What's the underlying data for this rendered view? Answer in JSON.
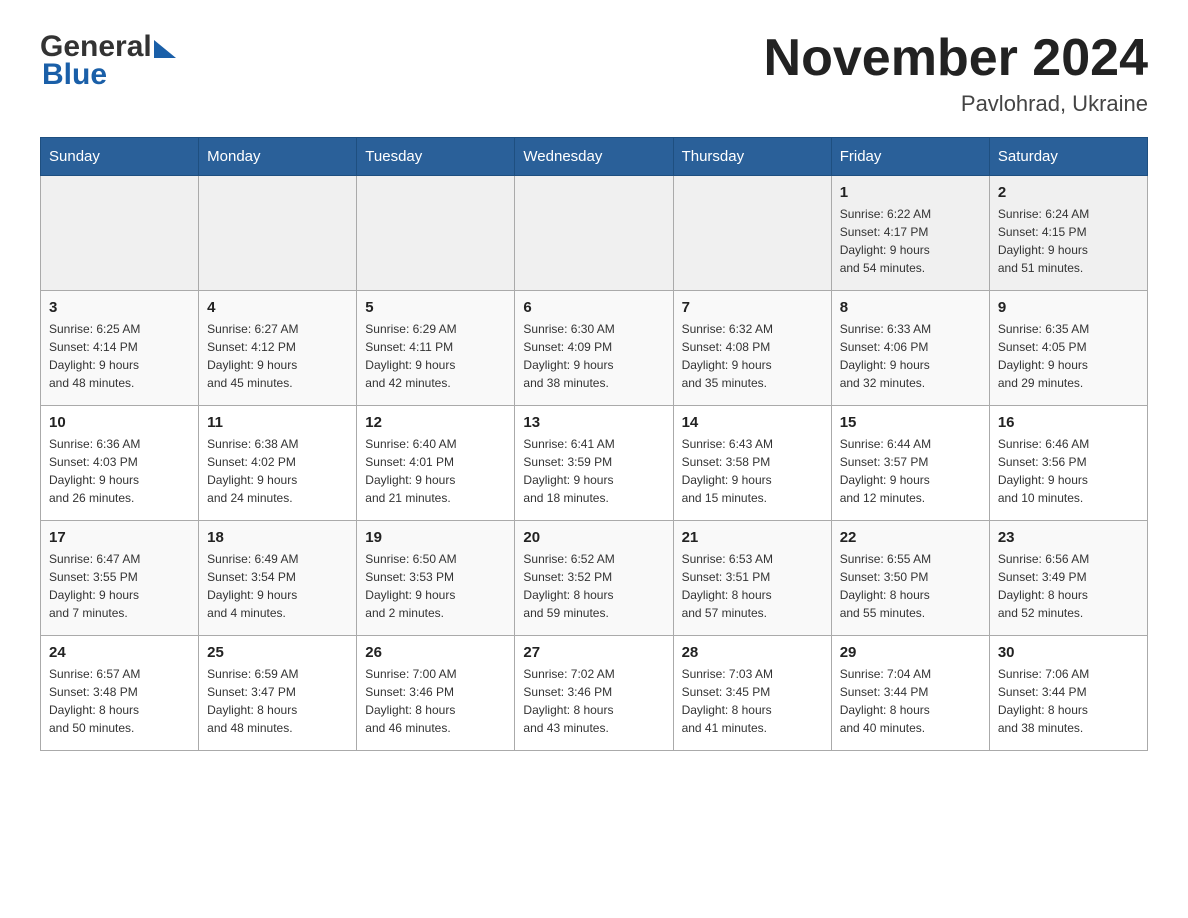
{
  "header": {
    "title": "November 2024",
    "subtitle": "Pavlohrad, Ukraine"
  },
  "logo": {
    "line1": "General",
    "line2": "Blue"
  },
  "days_of_week": [
    "Sunday",
    "Monday",
    "Tuesday",
    "Wednesday",
    "Thursday",
    "Friday",
    "Saturday"
  ],
  "weeks": [
    [
      {
        "day": "",
        "info": ""
      },
      {
        "day": "",
        "info": ""
      },
      {
        "day": "",
        "info": ""
      },
      {
        "day": "",
        "info": ""
      },
      {
        "day": "",
        "info": ""
      },
      {
        "day": "1",
        "info": "Sunrise: 6:22 AM\nSunset: 4:17 PM\nDaylight: 9 hours\nand 54 minutes."
      },
      {
        "day": "2",
        "info": "Sunrise: 6:24 AM\nSunset: 4:15 PM\nDaylight: 9 hours\nand 51 minutes."
      }
    ],
    [
      {
        "day": "3",
        "info": "Sunrise: 6:25 AM\nSunset: 4:14 PM\nDaylight: 9 hours\nand 48 minutes."
      },
      {
        "day": "4",
        "info": "Sunrise: 6:27 AM\nSunset: 4:12 PM\nDaylight: 9 hours\nand 45 minutes."
      },
      {
        "day": "5",
        "info": "Sunrise: 6:29 AM\nSunset: 4:11 PM\nDaylight: 9 hours\nand 42 minutes."
      },
      {
        "day": "6",
        "info": "Sunrise: 6:30 AM\nSunset: 4:09 PM\nDaylight: 9 hours\nand 38 minutes."
      },
      {
        "day": "7",
        "info": "Sunrise: 6:32 AM\nSunset: 4:08 PM\nDaylight: 9 hours\nand 35 minutes."
      },
      {
        "day": "8",
        "info": "Sunrise: 6:33 AM\nSunset: 4:06 PM\nDaylight: 9 hours\nand 32 minutes."
      },
      {
        "day": "9",
        "info": "Sunrise: 6:35 AM\nSunset: 4:05 PM\nDaylight: 9 hours\nand 29 minutes."
      }
    ],
    [
      {
        "day": "10",
        "info": "Sunrise: 6:36 AM\nSunset: 4:03 PM\nDaylight: 9 hours\nand 26 minutes."
      },
      {
        "day": "11",
        "info": "Sunrise: 6:38 AM\nSunset: 4:02 PM\nDaylight: 9 hours\nand 24 minutes."
      },
      {
        "day": "12",
        "info": "Sunrise: 6:40 AM\nSunset: 4:01 PM\nDaylight: 9 hours\nand 21 minutes."
      },
      {
        "day": "13",
        "info": "Sunrise: 6:41 AM\nSunset: 3:59 PM\nDaylight: 9 hours\nand 18 minutes."
      },
      {
        "day": "14",
        "info": "Sunrise: 6:43 AM\nSunset: 3:58 PM\nDaylight: 9 hours\nand 15 minutes."
      },
      {
        "day": "15",
        "info": "Sunrise: 6:44 AM\nSunset: 3:57 PM\nDaylight: 9 hours\nand 12 minutes."
      },
      {
        "day": "16",
        "info": "Sunrise: 6:46 AM\nSunset: 3:56 PM\nDaylight: 9 hours\nand 10 minutes."
      }
    ],
    [
      {
        "day": "17",
        "info": "Sunrise: 6:47 AM\nSunset: 3:55 PM\nDaylight: 9 hours\nand 7 minutes."
      },
      {
        "day": "18",
        "info": "Sunrise: 6:49 AM\nSunset: 3:54 PM\nDaylight: 9 hours\nand 4 minutes."
      },
      {
        "day": "19",
        "info": "Sunrise: 6:50 AM\nSunset: 3:53 PM\nDaylight: 9 hours\nand 2 minutes."
      },
      {
        "day": "20",
        "info": "Sunrise: 6:52 AM\nSunset: 3:52 PM\nDaylight: 8 hours\nand 59 minutes."
      },
      {
        "day": "21",
        "info": "Sunrise: 6:53 AM\nSunset: 3:51 PM\nDaylight: 8 hours\nand 57 minutes."
      },
      {
        "day": "22",
        "info": "Sunrise: 6:55 AM\nSunset: 3:50 PM\nDaylight: 8 hours\nand 55 minutes."
      },
      {
        "day": "23",
        "info": "Sunrise: 6:56 AM\nSunset: 3:49 PM\nDaylight: 8 hours\nand 52 minutes."
      }
    ],
    [
      {
        "day": "24",
        "info": "Sunrise: 6:57 AM\nSunset: 3:48 PM\nDaylight: 8 hours\nand 50 minutes."
      },
      {
        "day": "25",
        "info": "Sunrise: 6:59 AM\nSunset: 3:47 PM\nDaylight: 8 hours\nand 48 minutes."
      },
      {
        "day": "26",
        "info": "Sunrise: 7:00 AM\nSunset: 3:46 PM\nDaylight: 8 hours\nand 46 minutes."
      },
      {
        "day": "27",
        "info": "Sunrise: 7:02 AM\nSunset: 3:46 PM\nDaylight: 8 hours\nand 43 minutes."
      },
      {
        "day": "28",
        "info": "Sunrise: 7:03 AM\nSunset: 3:45 PM\nDaylight: 8 hours\nand 41 minutes."
      },
      {
        "day": "29",
        "info": "Sunrise: 7:04 AM\nSunset: 3:44 PM\nDaylight: 8 hours\nand 40 minutes."
      },
      {
        "day": "30",
        "info": "Sunrise: 7:06 AM\nSunset: 3:44 PM\nDaylight: 8 hours\nand 38 minutes."
      }
    ]
  ]
}
